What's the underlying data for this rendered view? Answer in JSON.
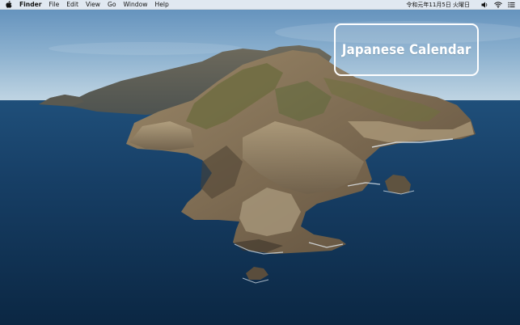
{
  "menubar": {
    "app_name": "Finder",
    "items": [
      "File",
      "Edit",
      "View",
      "Go",
      "Window",
      "Help"
    ],
    "clock": "令和元年11月5日 火曜日",
    "icons": [
      "apple-icon",
      "volume-icon",
      "wifi-icon",
      "list-icon"
    ]
  },
  "overlay": {
    "title": "Japanese Calendar"
  },
  "colors": {
    "sky_top": "#5f8fbb",
    "sky_horizon": "#bcd3e3",
    "sea_deep": "#0c2a48",
    "sea_mid": "#1d4c77",
    "island": "#8b7a5e",
    "badge_border": "#ffffff"
  }
}
